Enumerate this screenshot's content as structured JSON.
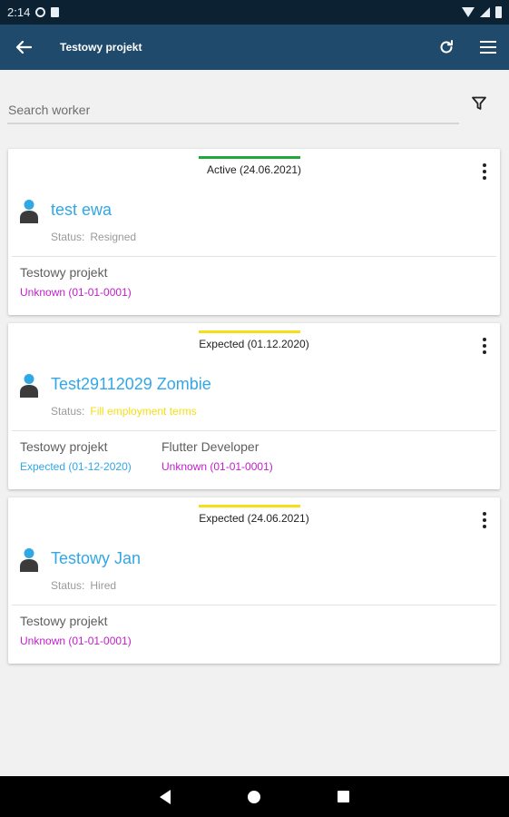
{
  "status_bar": {
    "time": "2:14",
    "icons": [
      "gear-icon",
      "sim-icon",
      "wifi-icon",
      "signal-icon",
      "battery-icon"
    ]
  },
  "app_bar": {
    "title": "Testowy projekt",
    "back_icon": "arrow-left-icon",
    "refresh_icon": "refresh-icon",
    "menu_icon": "hamburger-menu-icon",
    "background": "#1f4a6b"
  },
  "search": {
    "placeholder": "Search worker",
    "value": "",
    "filter_icon": "filter-icon"
  },
  "colors": {
    "active": "#22a839",
    "expected": "#f4de16",
    "name_link": "#31a7e6",
    "unknown": "#c020c9",
    "expected_text": "#31a7e6",
    "resigned_text": "#9a9a9a",
    "hired_text": "#9a9a9a",
    "fill_terms_text": "#f4de16"
  },
  "cards": [
    {
      "state_label": "Active (24.06.2021)",
      "state_color": "#22a839",
      "name": "test ewa",
      "status_label": "Status:",
      "status_value": "Resigned",
      "status_color": "#9a9a9a",
      "projects": [
        {
          "name": "Testowy projekt",
          "state": "Unknown (01-01-0001)",
          "state_color": "#c020c9"
        }
      ]
    },
    {
      "state_label": "Expected (01.12.2020)",
      "state_color": "#f4de16",
      "name": "Test29112029 Zombie",
      "status_label": "Status:",
      "status_value": "Fill employment terms",
      "status_color": "#f4de16",
      "projects": [
        {
          "name": "Testowy projekt",
          "state": "Expected (01-12-2020)",
          "state_color": "#31a7e6"
        },
        {
          "name": "Flutter Developer",
          "state": "Unknown (01-01-0001)",
          "state_color": "#c020c9"
        }
      ]
    },
    {
      "state_label": "Expected (24.06.2021)",
      "state_color": "#f4de16",
      "name": "Testowy Jan",
      "status_label": "Status:",
      "status_value": "Hired",
      "status_color": "#9a9a9a",
      "projects": [
        {
          "name": "Testowy projekt",
          "state": "Unknown (01-01-0001)",
          "state_color": "#c020c9"
        }
      ]
    }
  ],
  "nav_bar": {
    "icons": [
      "nav-back-icon",
      "nav-home-icon",
      "nav-recents-icon"
    ]
  }
}
